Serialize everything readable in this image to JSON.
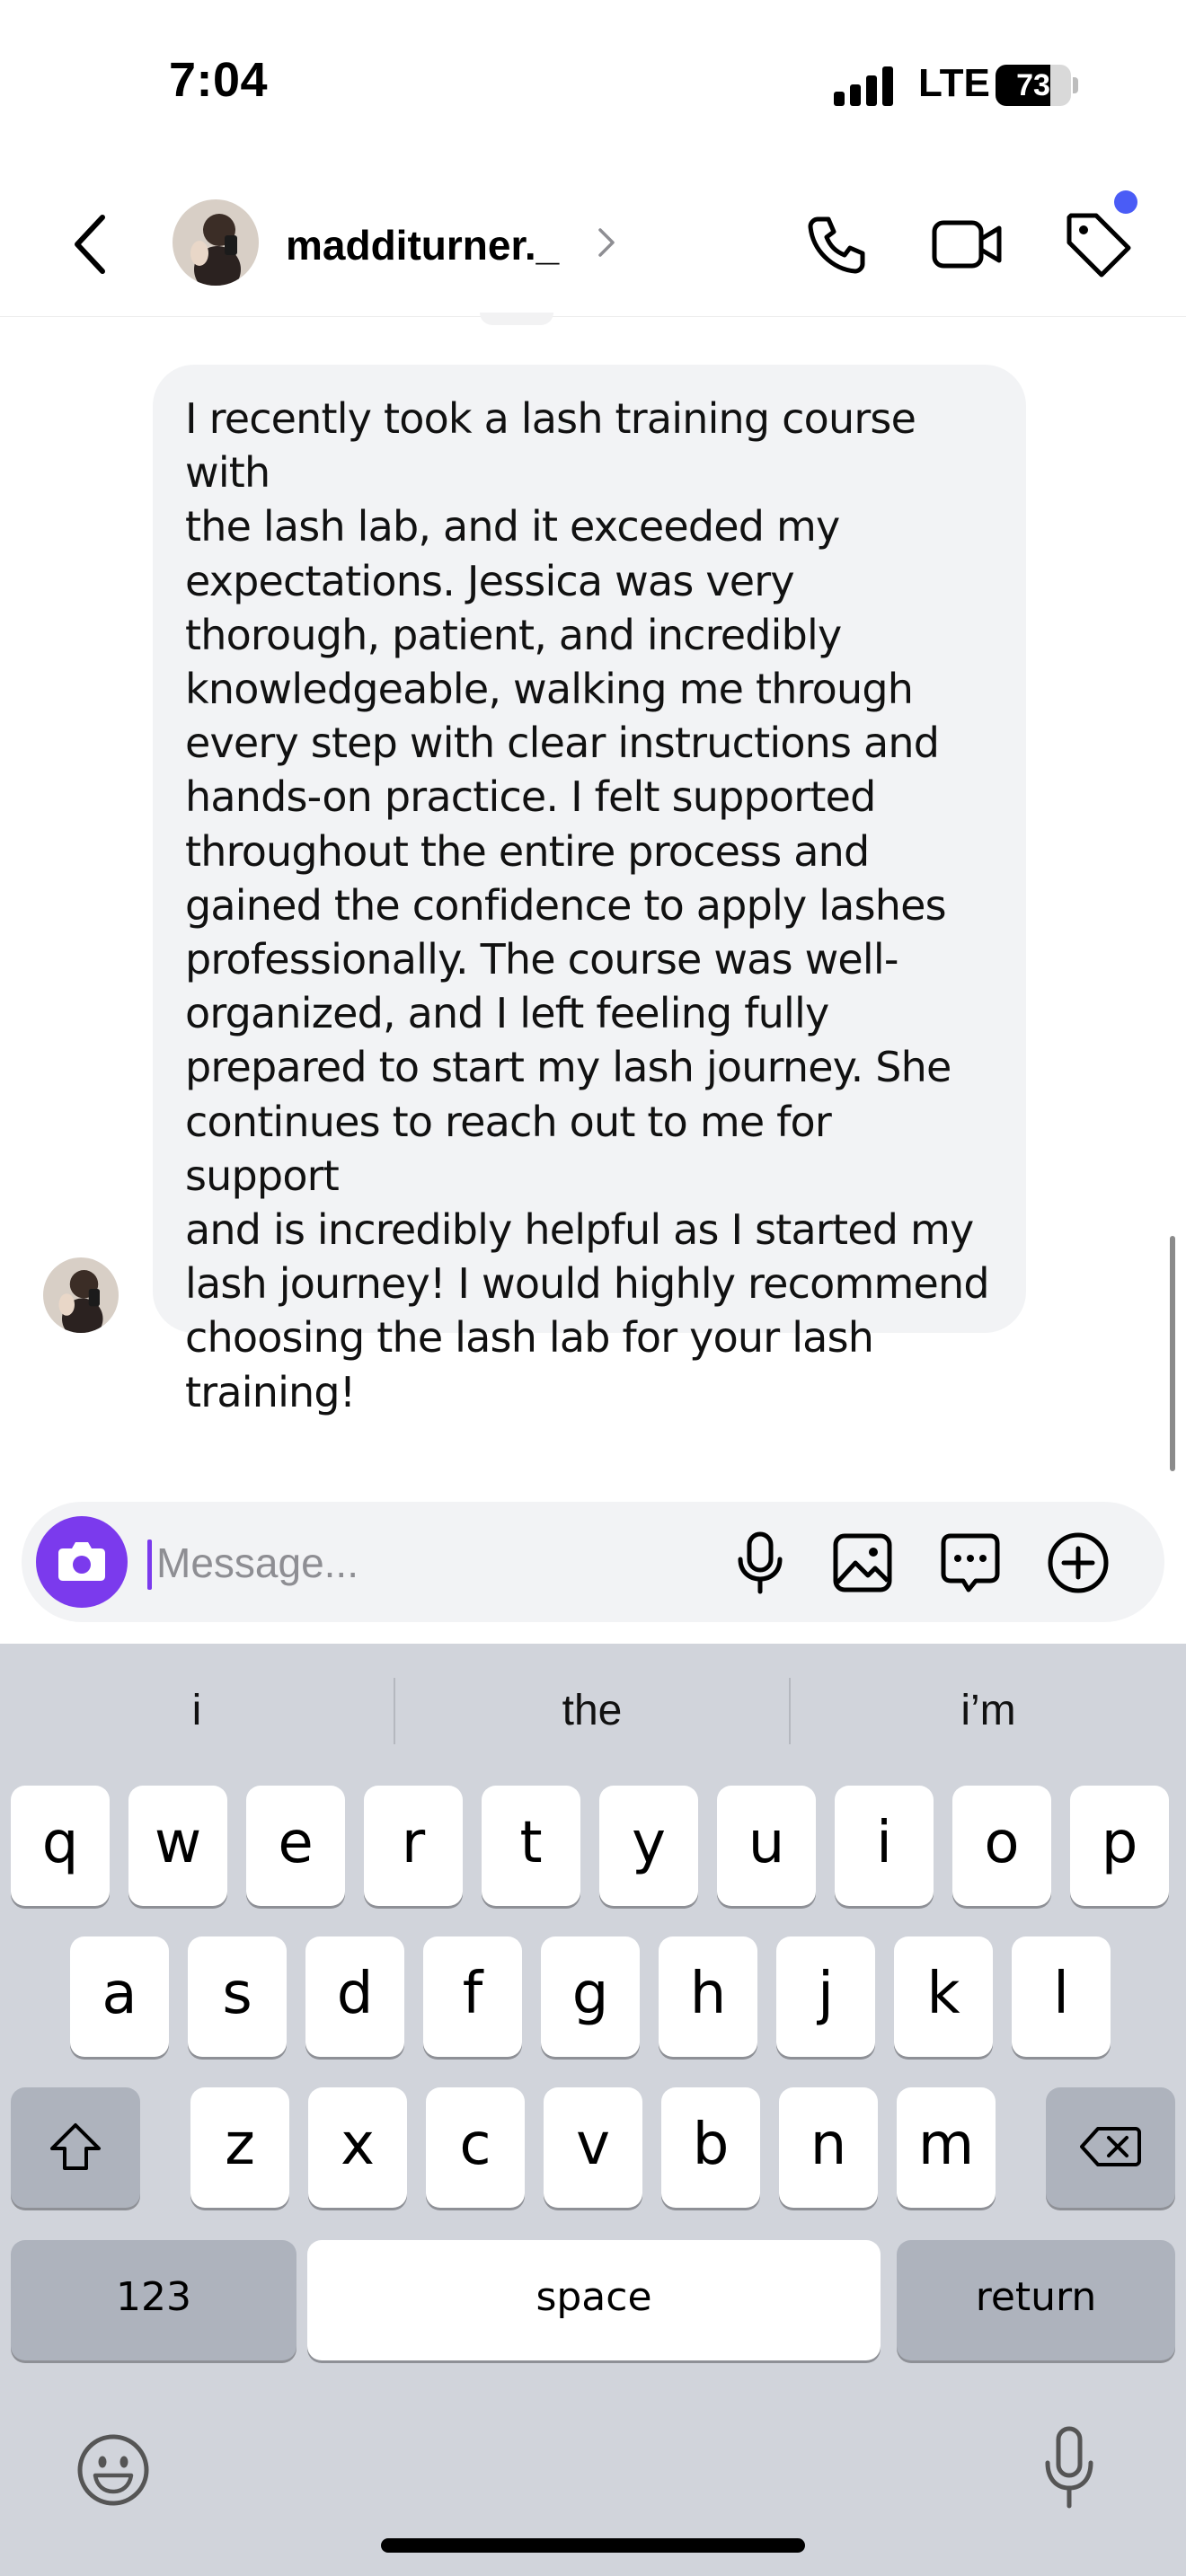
{
  "status_bar": {
    "time": "7:04",
    "network": "LTE",
    "battery": "73",
    "battery_level": 0.73
  },
  "header": {
    "username": "madditurner._"
  },
  "messages": [
    {
      "sender": "madditurner._",
      "text": "I recently took a lash training course with\nthe lash lab, and it exceeded my\nexpectations. Jessica was very\nthorough, patient, and incredibly\nknowledgeable, walking me through\nevery step with clear instructions and\nhands-on practice. I felt supported\nthroughout the entire process and\ngained the confidence to apply lashes\nprofessionally. The course was well-\norganized, and I left feeling fully\nprepared to start my lash journey. She\ncontinues to reach out to me for support\nand is incredibly helpful as I started my\nlash journey! I would highly recommend\nchoosing the lash lab for your lash\ntraining!"
    }
  ],
  "composer": {
    "placeholder": "Message..."
  },
  "keyboard": {
    "suggestions": [
      "i",
      "the",
      "i’m"
    ],
    "row1": [
      "q",
      "w",
      "e",
      "r",
      "t",
      "y",
      "u",
      "i",
      "o",
      "p"
    ],
    "row2": [
      "a",
      "s",
      "d",
      "f",
      "g",
      "h",
      "j",
      "k",
      "l"
    ],
    "row3": [
      "z",
      "x",
      "c",
      "v",
      "b",
      "n",
      "m"
    ],
    "numbers_label": "123",
    "space_label": "space",
    "return_label": "return"
  },
  "colors": {
    "accent": "#7b3aed",
    "notification_dot": "#4a5cf6",
    "bubble": "#f2f3f5"
  },
  "icons": [
    "back-icon",
    "phone-icon",
    "video-icon",
    "tag-icon",
    "camera-icon",
    "mic-icon",
    "gallery-icon",
    "sticker-icon",
    "plus-icon",
    "shift-icon",
    "backspace-icon",
    "emoji-icon"
  ]
}
